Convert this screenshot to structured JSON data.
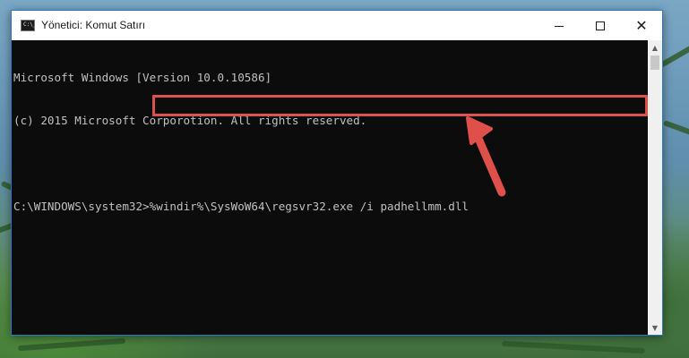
{
  "window": {
    "title": "Yönetici: Komut Satırı",
    "icon": "cmd-icon",
    "icon_text": "C:\\_",
    "controls": {
      "minimize": "minimize-icon",
      "maximize": "maximize-icon",
      "close_glyph": "✕"
    }
  },
  "console": {
    "lines": [
      "Microsoft Windows [Version 10.0.10586]",
      "(c) 2015 Microsoft Corporotion. All rights reserved.",
      ""
    ],
    "prompt": "C:\\WINDOWS\\system32>",
    "command": "%windir%\\SysWoW64\\regsvr32.exe /i padhellmm.dll"
  },
  "annotation": {
    "highlight_color": "#e0504a",
    "arrow_color": "#e0504a",
    "arrow_icon": "pointer-arrow-icon"
  },
  "colors": {
    "console_bg": "#0c0c0c",
    "console_text": "#c0c0c0",
    "window_border": "#2b78c6"
  }
}
